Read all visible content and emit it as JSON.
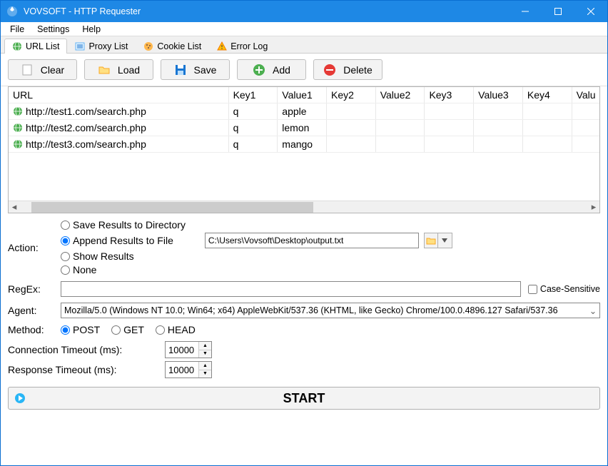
{
  "window": {
    "title": "VOVSOFT - HTTP Requester"
  },
  "menu": {
    "file": "File",
    "settings": "Settings",
    "help": "Help"
  },
  "tabs": {
    "urllist": "URL List",
    "proxylist": "Proxy List",
    "cookielist": "Cookie List",
    "errorlog": "Error Log"
  },
  "toolbar": {
    "clear": "Clear",
    "load": "Load",
    "save": "Save",
    "add": "Add",
    "delete": "Delete"
  },
  "grid": {
    "headers": {
      "url": "URL",
      "key1": "Key1",
      "val1": "Value1",
      "key2": "Key2",
      "val2": "Value2",
      "key3": "Key3",
      "val3": "Value3",
      "key4": "Key4",
      "val4": "Valu"
    },
    "rows": [
      {
        "url": "http://test1.com/search.php",
        "key1": "q",
        "val1": "apple"
      },
      {
        "url": "http://test2.com/search.php",
        "key1": "q",
        "val1": "lemon"
      },
      {
        "url": "http://test3.com/search.php",
        "key1": "q",
        "val1": "mango"
      }
    ]
  },
  "form": {
    "action_label": "Action:",
    "action_opts": {
      "save_dir": "Save Results to Directory",
      "append_file": "Append Results to File",
      "show": "Show Results",
      "none": "None"
    },
    "file_path": "C:\\Users\\Vovsoft\\Desktop\\output.txt",
    "regex_label": "RegEx:",
    "regex_value": "",
    "case_sensitive": "Case-Sensitive",
    "agent_label": "Agent:",
    "agent_value": "Mozilla/5.0 (Windows NT 10.0; Win64; x64) AppleWebKit/537.36 (KHTML, like Gecko) Chrome/100.0.4896.127 Safari/537.36",
    "method_label": "Method:",
    "method_opts": {
      "post": "POST",
      "get": "GET",
      "head": "HEAD"
    },
    "conn_timeout_label": "Connection Timeout (ms):",
    "conn_timeout_value": "10000",
    "resp_timeout_label": "Response Timeout (ms):",
    "resp_timeout_value": "10000"
  },
  "start": "START"
}
